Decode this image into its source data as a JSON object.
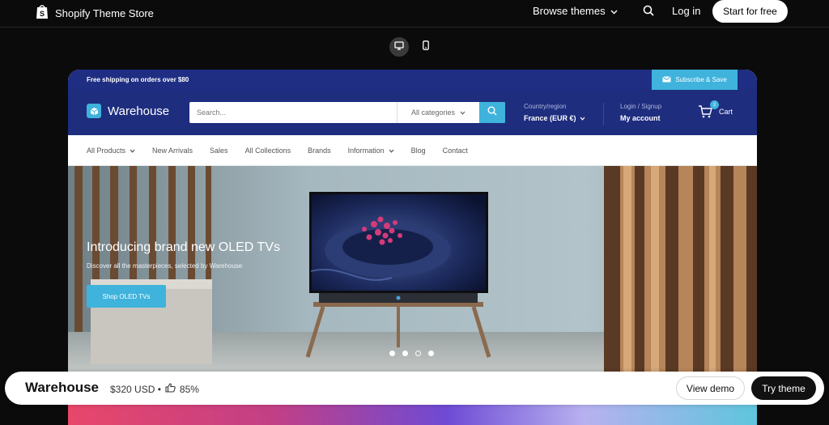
{
  "topbar": {
    "brand": "Shopify Theme Store",
    "browse": "Browse themes",
    "login": "Log in",
    "start": "Start for free"
  },
  "store": {
    "announcement": "Free shipping on orders over $80",
    "subscribe": "Subscribe & Save",
    "logo": "Warehouse",
    "search_placeholder": "Search...",
    "categories": "All categories",
    "region_label": "Country/region",
    "region_value": "France (EUR €)",
    "account_label": "Login / Signup",
    "account_value": "My account",
    "cart_label": "Cart",
    "cart_count": "2",
    "menu": [
      "All Products",
      "New Arrivals",
      "Sales",
      "All Collections",
      "Brands",
      "Information",
      "Blog",
      "Contact"
    ],
    "hero": {
      "title": "Introducing brand new OLED TVs",
      "subtitle": "Discover all the masterpieces, selected by Warehouse",
      "button": "Shop OLED TVs"
    }
  },
  "theme": {
    "name": "Warehouse",
    "price": "$320 USD •",
    "rating": "85%",
    "view_demo": "View demo",
    "try_theme": "Try theme"
  },
  "colors": {
    "store_blue": "#1e2d7e",
    "accent": "#3fb3dc"
  }
}
